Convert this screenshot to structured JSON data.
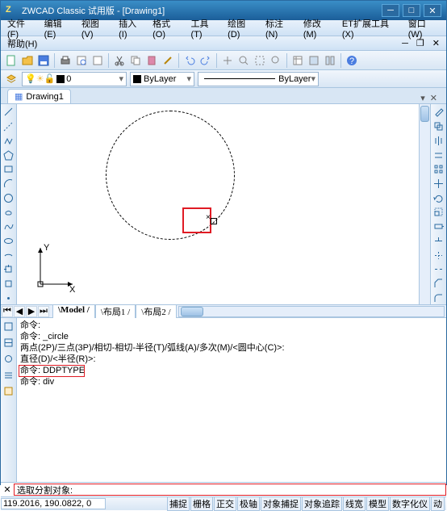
{
  "title": "ZWCAD Classic 试用版 - [Drawing1]",
  "menus": [
    "文件(F)",
    "编辑(E)",
    "视图(V)",
    "插入(I)",
    "格式(O)",
    "工具(T)",
    "绘图(D)",
    "标注(N)",
    "修改(M)",
    "ET扩展工具(X)",
    "窗口(W)"
  ],
  "menus2": [
    "帮助(H)"
  ],
  "layer_value": "0",
  "bylayer1": "ByLayer",
  "bylayer2": "ByLayer",
  "doc_tab": "Drawing1",
  "ucs": {
    "x": "X",
    "y": "Y"
  },
  "model_tabs": [
    "Model",
    "布局1",
    "布局2"
  ],
  "cmd_lines": [
    "命令:",
    "命令: _circle",
    "两点(2P)/三点(3P)/相切-相切-半径(T)/弧线(A)/多次(M)/<圆中心(C)>:",
    "直径(D)/<半径(R)>:",
    "命令: DDPTYPE",
    "命令: div"
  ],
  "cmd_prompt": "选取分割对象:",
  "coords": "119.2016,  190.0822,  0",
  "status_btns": [
    "捕捉",
    "栅格",
    "正交",
    "极轴",
    "对象捕捉",
    "对象追踪",
    "线宽",
    "模型",
    "数字化仪",
    "动"
  ]
}
